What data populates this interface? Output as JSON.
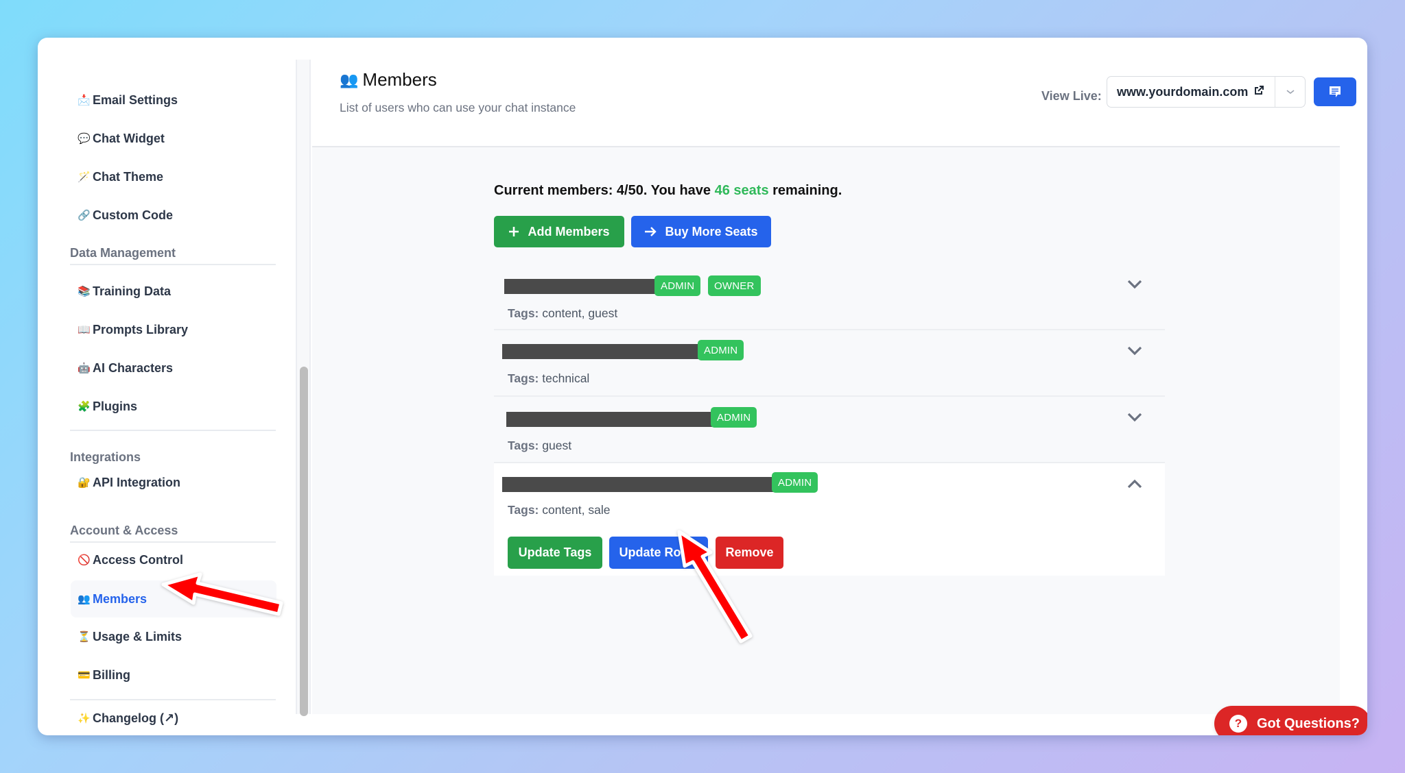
{
  "sidebar": {
    "items_top": [
      {
        "emoji": "📩",
        "icon": "envelope-icon",
        "label": "Email Settings"
      },
      {
        "emoji": "💬",
        "icon": "speech-bubble-icon",
        "label": "Chat Widget"
      },
      {
        "emoji": "🪄",
        "icon": "magic-wand-icon",
        "label": "Chat Theme"
      },
      {
        "emoji": "🔗",
        "icon": "link-icon",
        "label": "Custom Code"
      }
    ],
    "sections": [
      {
        "title": "Data Management",
        "items": [
          {
            "emoji": "📚",
            "icon": "books-icon",
            "label": "Training Data"
          },
          {
            "emoji": "📖",
            "icon": "open-book-icon",
            "label": "Prompts Library"
          },
          {
            "emoji": "🤖",
            "icon": "robot-icon",
            "label": "AI Characters"
          },
          {
            "emoji": "🧩",
            "icon": "puzzle-icon",
            "label": "Plugins"
          }
        ]
      },
      {
        "title": "Integrations",
        "items": [
          {
            "emoji": "🔐",
            "icon": "lock-key-icon",
            "label": "API Integration"
          }
        ]
      },
      {
        "title": "Account & Access",
        "items": [
          {
            "emoji": "🚫",
            "icon": "prohibited-icon",
            "label": "Access Control"
          },
          {
            "emoji": "👥",
            "icon": "users-icon",
            "label": "Members",
            "active": true
          },
          {
            "emoji": "⏳",
            "icon": "hourglass-icon",
            "label": "Usage & Limits"
          },
          {
            "emoji": "💳",
            "icon": "credit-card-icon",
            "label": "Billing"
          }
        ]
      }
    ],
    "footer_item": {
      "emoji": "✨",
      "icon": "sparkles-icon",
      "label": "Changelog (↗)"
    }
  },
  "header": {
    "title_emoji": "👥",
    "title": "Members",
    "subtitle": "List of users who can use your chat instance",
    "view_live_label": "View Live:",
    "domain_value": "www.yourdomain.com"
  },
  "main": {
    "summary": {
      "prefix": "Current members: 4/50. You have ",
      "highlight": "46 seats",
      "suffix": " remaining."
    },
    "add_members_label": "Add Members",
    "buy_seats_label": "Buy More Seats",
    "members": [
      {
        "name": "[redacted]",
        "roles": [
          "ADMIN",
          "OWNER"
        ],
        "tags_label": "Tags:",
        "tags": "content, guest",
        "expanded": false
      },
      {
        "name": "[redacted]",
        "roles": [
          "ADMIN"
        ],
        "tags_label": "Tags:",
        "tags": "technical",
        "expanded": false
      },
      {
        "name": "[redacted]",
        "roles": [
          "ADMIN"
        ],
        "tags_label": "Tags:",
        "tags": "guest",
        "expanded": false
      },
      {
        "name": "[redacted]",
        "roles": [
          "ADMIN"
        ],
        "tags_label": "Tags:",
        "tags": "content, sale",
        "expanded": true
      }
    ],
    "actions": {
      "update_tags": "Update Tags",
      "update_roles": "Update Roles",
      "remove": "Remove"
    }
  },
  "help_button_label": "Got Questions?",
  "colors": {
    "primary_blue": "#2563eb",
    "success_green": "#28a04a",
    "badge_green": "#33c35d",
    "danger_red": "#dc2626",
    "annotation_red": "#ff0000"
  }
}
